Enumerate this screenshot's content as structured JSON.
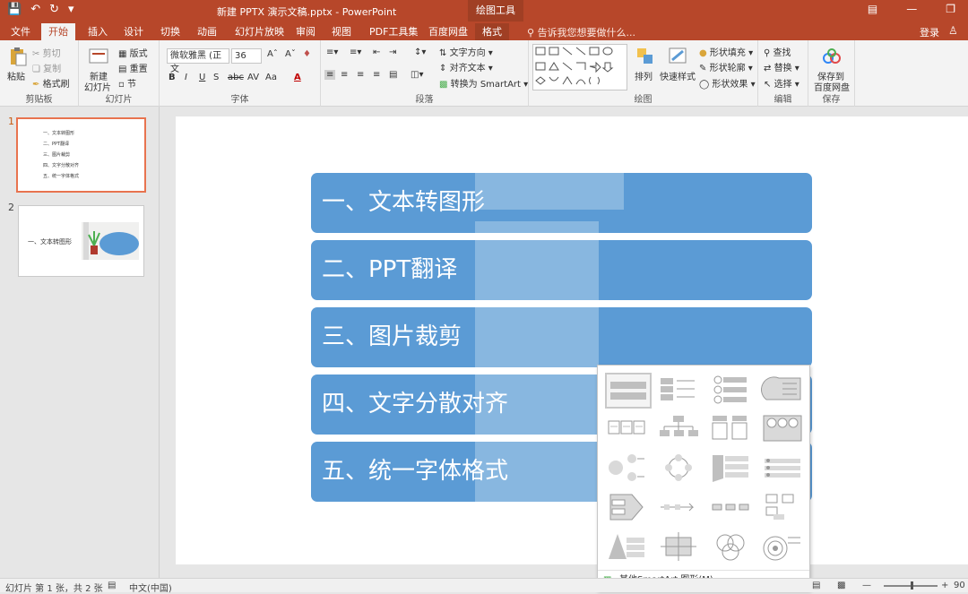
{
  "titlebar": {
    "doc_title": "新建 PPTX 演示文稿.pptx - PowerPoint",
    "context_group": "绘图工具"
  },
  "tabs": [
    "文件",
    "开始",
    "插入",
    "设计",
    "切换",
    "动画",
    "幻灯片放映",
    "审阅",
    "视图",
    "PDF工具集",
    "百度网盘",
    "格式"
  ],
  "tellme": "告诉我您想要做什么...",
  "login": "登录",
  "ribbon": {
    "clipboard": {
      "paste": "粘贴",
      "cut": "剪切",
      "copy": "复制",
      "painter": "格式刷",
      "label": "剪贴板"
    },
    "slides": {
      "new_slide": "新建",
      "new_slide2": "幻灯片",
      "layout": "版式",
      "reset": "重置",
      "section": "节",
      "label": "幻灯片"
    },
    "font": {
      "name": "微软雅黑 (正文",
      "size": "36",
      "label": "字体"
    },
    "paragraph": {
      "direction": "文字方向",
      "align": "对齐文本",
      "smartart": "转换为 SmartArt",
      "label": "段落"
    },
    "drawing": {
      "arrange": "排列",
      "quick_styles": "快速样式",
      "fill": "形状填充",
      "outline": "形状轮廓",
      "effects": "形状效果",
      "label": "绘图"
    },
    "editing": {
      "find": "查找",
      "replace": "替换",
      "select": "选择",
      "label": "编辑"
    },
    "save": {
      "save_to": "保存到",
      "baidu": "百度网盘",
      "label": "保存"
    }
  },
  "thumbnails": [
    {
      "num": "1",
      "lines": [
        "一、文本转图形",
        "二、PPT翻译",
        "三、图片裁剪",
        "四、文字分散对齐",
        "五、统一字体格式"
      ]
    },
    {
      "num": "2",
      "title": "一、文本转图形"
    }
  ],
  "slide_bars": [
    "一、文本转图形",
    "二、PPT翻译",
    "三、图片裁剪",
    "四、文字分散对齐",
    "五、统一字体格式"
  ],
  "dropdown": {
    "more": "其他SmartArt 图形(M)..."
  },
  "statusbar": {
    "slide_info": "幻灯片 第 1 张，共 2 张",
    "lang": "中文(中国)",
    "zoom": "90"
  },
  "colors": {
    "accent": "#b7472a",
    "bar": "#5b9bd5"
  }
}
